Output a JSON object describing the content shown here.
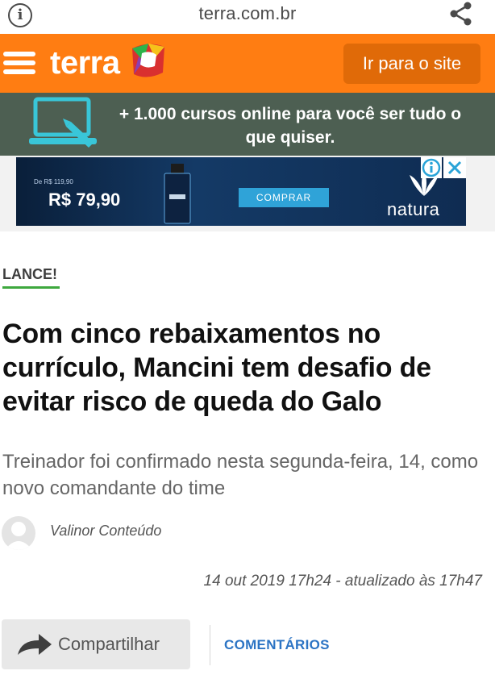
{
  "browser": {
    "url": "terra.com.br",
    "info_icon": "info-icon",
    "share_icon": "share-icon"
  },
  "header": {
    "logo_text": "terra",
    "menu_icon": "hamburger-icon",
    "goto_site_label": "Ir para o site",
    "accent": "#ff7d12"
  },
  "promo": {
    "text": "+ 1.000 cursos online para você ser tudo o que quiser.",
    "icon": "laptop-pencil-icon",
    "background": "#4d5f52"
  },
  "ad": {
    "small_text": "De R$ 119,90",
    "price": "R$ 79,90",
    "buy_label": "COMPRAR",
    "brand": "natura"
  },
  "article": {
    "source": "LANCE!",
    "headline": "Com cinco rebaixamentos no currículo, Mancini tem desafio de evitar risco de queda do Galo",
    "subtitle": "Treinador foi confirmado nesta segunda-feira, 14, como novo comandante do time",
    "author": "Valinor Conteúdo",
    "date": "14 out 2019 17h24 - atualizado às 17h47"
  },
  "actions": {
    "share_label": "Compartilhar",
    "comments_label": "COMENTÁRIOS",
    "comments_color": "#2c74c4"
  }
}
